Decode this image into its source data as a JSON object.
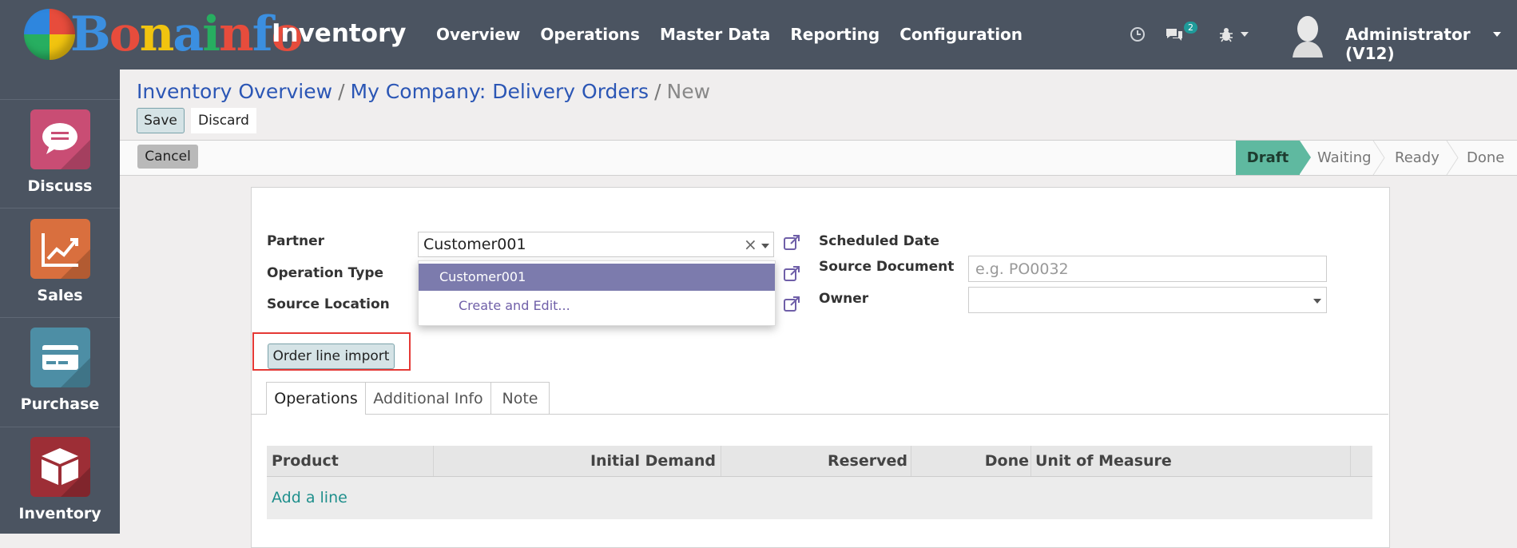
{
  "brand": {
    "logo_text": "Bonainfo",
    "app_name": "Inventory"
  },
  "top_menu": [
    "Overview",
    "Operations",
    "Master Data",
    "Reporting",
    "Configuration"
  ],
  "systray": {
    "clock_icon": "clock-icon",
    "chat_icon": "chat-icon",
    "chat_badge": "2",
    "debug_icon": "bug-icon"
  },
  "user": {
    "name": "Administrator (V12)"
  },
  "sidebar": {
    "items": [
      {
        "label": "Discuss",
        "icon": "chat-bubble-icon",
        "color": "#c94d74"
      },
      {
        "label": "Sales",
        "icon": "trend-chart-icon",
        "color": "#d96f3e"
      },
      {
        "label": "Purchase",
        "icon": "credit-card-icon",
        "color": "#4d8ea5"
      },
      {
        "label": "Inventory",
        "icon": "box-icon",
        "color": "#9d2e36"
      }
    ]
  },
  "breadcrumb": {
    "items": [
      "Inventory Overview",
      "My Company: Delivery Orders"
    ],
    "separator": "/",
    "current": "New"
  },
  "control": {
    "save_label": "Save",
    "discard_label": "Discard"
  },
  "statusbar": {
    "cancel_label": "Cancel",
    "stages": [
      "Draft",
      "Waiting",
      "Ready",
      "Done"
    ],
    "active_stage": "Draft",
    "active_color": "#5fb9a0"
  },
  "form": {
    "partner": {
      "label": "Partner",
      "value": "Customer001"
    },
    "operation_type": {
      "label": "Operation Type"
    },
    "source_location": {
      "label": "Source Location"
    },
    "scheduled_date": {
      "label": "Scheduled Date"
    },
    "source_document": {
      "label": "Source Document",
      "placeholder": "e.g. PO0032"
    },
    "owner": {
      "label": "Owner"
    },
    "dropdown": {
      "selected": "Customer001",
      "create_label": "Create and Edit..."
    },
    "order_line_import_label": "Order line import",
    "tabs": [
      "Operations",
      "Additional Info",
      "Note"
    ],
    "active_tab": "Operations"
  },
  "table": {
    "columns": [
      "Product",
      "Initial Demand",
      "Reserved",
      "Done",
      "Unit of Measure"
    ],
    "add_line": "Add a line"
  }
}
